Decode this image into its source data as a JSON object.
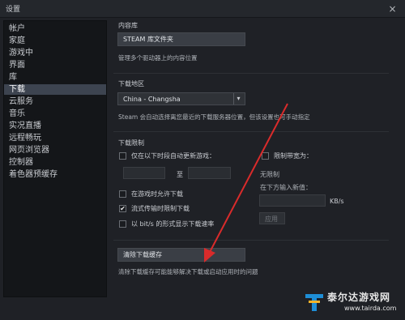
{
  "window": {
    "title": "设置",
    "close_glyph": "×"
  },
  "sidebar": {
    "items": [
      {
        "label": "帐户"
      },
      {
        "label": "家庭"
      },
      {
        "label": "游戏中"
      },
      {
        "label": "界面"
      },
      {
        "label": "库"
      },
      {
        "label": "下载",
        "active": true
      },
      {
        "label": "云服务"
      },
      {
        "label": "音乐"
      },
      {
        "label": "实况直播"
      },
      {
        "label": "远程畅玩"
      },
      {
        "label": "网页浏览器"
      },
      {
        "label": "控制器"
      },
      {
        "label": "着色器预缓存"
      }
    ]
  },
  "content_library": {
    "heading": "内容库",
    "button_label": "STEAM 库文件夹",
    "description": "管理多个驱动器上的内容位置"
  },
  "download_region": {
    "heading": "下载地区",
    "selected_value": "China - Changsha",
    "dropdown_glyph": "▾",
    "description": "Steam 会自动选择离您最近的下载服务器位置，但该设置也可手动指定"
  },
  "download_restrictions": {
    "heading": "下载限制",
    "only_during_label": "仅在以下时段自动更新游戏：",
    "to_label": "至",
    "allow_during_play_label": "在游戏时允许下载",
    "throttle_streaming_label": "流式传输时限制下载",
    "throttle_streaming_checked": true,
    "show_bits_label": "以 bit/s 的形式显示下载速率",
    "limit_bandwidth_label": "限制带宽为：",
    "no_limit_label": "无限制",
    "enter_new_value_label": "在下方输入新值：",
    "unit_label": "KB/s",
    "apply_label": "应用"
  },
  "clear_cache": {
    "button_label": "清除下载缓存",
    "description": "清除下载缓存可能能够解决下载或启动应用时的问题"
  },
  "watermark": {
    "text": "泰尔达游戏网",
    "url": "www.tairda.com"
  },
  "colors": {
    "background": "#1f2126",
    "sidebar_bg": "#141619",
    "active_item": "#3d4450",
    "button_bg": "#3a3e45",
    "annotation_arrow": "#d92b2b"
  }
}
